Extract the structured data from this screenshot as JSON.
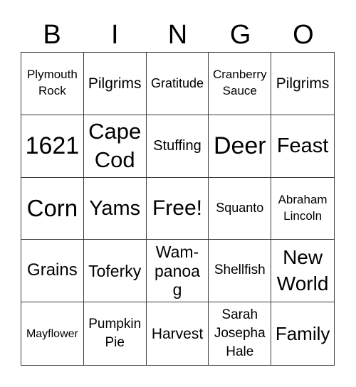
{
  "header": {
    "letters": [
      "B",
      "I",
      "N",
      "G",
      "O"
    ]
  },
  "grid": {
    "rows": [
      [
        "Plymouth Rock",
        "Pilgrims",
        "Gratitude",
        "Cranberry Sauce",
        "Pilgrims"
      ],
      [
        "1621",
        "Cape Cod",
        "Stuffing",
        "Deer",
        "Feast"
      ],
      [
        "Corn",
        "Yams",
        "Free!",
        "Squanto",
        "Abraham Lincoln"
      ],
      [
        "Grains",
        "Toferky",
        "Wam-panoag",
        "Shellfish",
        "New World"
      ],
      [
        "Mayflower",
        "Pumpkin Pie",
        "Harvest",
        "Sarah Josepha Hale",
        "Family"
      ]
    ]
  },
  "colors": {
    "grid_line": "#3a3a3a",
    "text": "#000000",
    "background": "#ffffff"
  }
}
